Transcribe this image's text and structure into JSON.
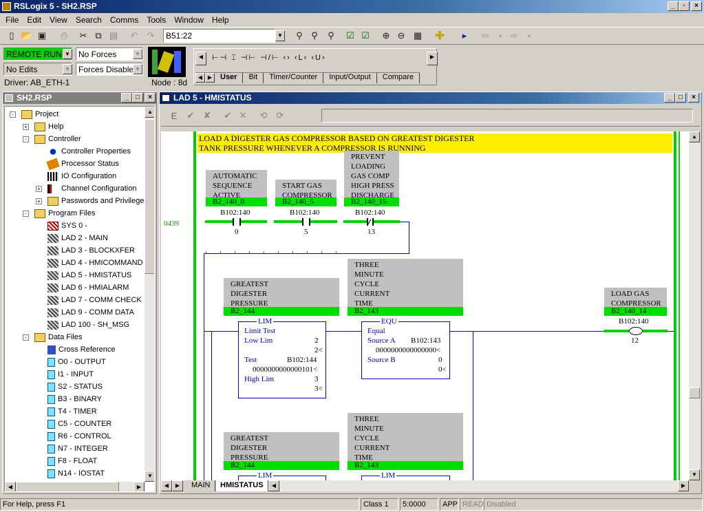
{
  "app": {
    "title": "RSLogix 5 - SH2.RSP",
    "menu": [
      "File",
      "Edit",
      "View",
      "Search",
      "Comms",
      "Tools",
      "Window",
      "Help"
    ]
  },
  "toolbar": {
    "address_value": "B51:22"
  },
  "online": {
    "mode": "REMOTE RUN",
    "forces": "No Forces",
    "edits": "No Edits",
    "forces_state": "Forces Disabled",
    "driver": "Driver: AB_ETH-1",
    "node": "Node : 8d"
  },
  "instruction_tabs": [
    "User",
    "Bit",
    "Timer/Counter",
    "Input/Output",
    "Compare"
  ],
  "project_panel": {
    "title": "SH2.RSP",
    "items": [
      {
        "label": "Project",
        "level": 0,
        "icon": "folder-icon",
        "exp": "-"
      },
      {
        "label": "Help",
        "level": 1,
        "icon": "folder-icon",
        "exp": "+"
      },
      {
        "label": "Controller",
        "level": 1,
        "icon": "folder-icon",
        "exp": "-"
      },
      {
        "label": "Controller Properties",
        "level": 2,
        "icon": "info-icon"
      },
      {
        "label": "Processor Status",
        "level": 2,
        "icon": "status-icon"
      },
      {
        "label": "IO Configuration",
        "level": 2,
        "icon": "io-icon"
      },
      {
        "label": "Channel Configuration",
        "level": 2,
        "icon": "channel-icon",
        "exp": "+"
      },
      {
        "label": "Passwords and Privileges",
        "level": 2,
        "icon": "folder-icon",
        "exp": "+"
      },
      {
        "label": "Program Files",
        "level": 1,
        "icon": "folder-icon",
        "exp": "-"
      },
      {
        "label": "SYS 0 -",
        "level": 2,
        "icon": "sys-file-icon"
      },
      {
        "label": "LAD 2 - MAIN",
        "level": 2,
        "icon": "ladder-file-icon"
      },
      {
        "label": "LAD 3 - BLOCKXFER",
        "level": 2,
        "icon": "ladder-file-icon"
      },
      {
        "label": "LAD 4 - HMICOMMAND",
        "level": 2,
        "icon": "ladder-file-icon"
      },
      {
        "label": "LAD 5 - HMISTATUS",
        "level": 2,
        "icon": "ladder-file-icon"
      },
      {
        "label": "LAD 6 - HMIALARM",
        "level": 2,
        "icon": "ladder-file-icon"
      },
      {
        "label": "LAD 7 - COMM CHECK",
        "level": 2,
        "icon": "ladder-file-icon"
      },
      {
        "label": "LAD 9 - COMM DATA",
        "level": 2,
        "icon": "ladder-file-icon"
      },
      {
        "label": "LAD 100 - SH_MSG",
        "level": 2,
        "icon": "ladder-file-icon"
      },
      {
        "label": "Data Files",
        "level": 1,
        "icon": "folder-icon",
        "exp": "-"
      },
      {
        "label": "Cross Reference",
        "level": 2,
        "icon": "cross-reference-icon"
      },
      {
        "label": "O0 - OUTPUT",
        "level": 2,
        "icon": "data-file-icon"
      },
      {
        "label": "I1 - INPUT",
        "level": 2,
        "icon": "data-file-icon"
      },
      {
        "label": "S2 - STATUS",
        "level": 2,
        "icon": "data-file-icon"
      },
      {
        "label": "B3 - BINARY",
        "level": 2,
        "icon": "data-file-icon"
      },
      {
        "label": "T4 - TIMER",
        "level": 2,
        "icon": "data-file-icon"
      },
      {
        "label": "C5 - COUNTER",
        "level": 2,
        "icon": "data-file-icon"
      },
      {
        "label": "R6 - CONTROL",
        "level": 2,
        "icon": "data-file-icon"
      },
      {
        "label": "N7 - INTEGER",
        "level": 2,
        "icon": "data-file-icon"
      },
      {
        "label": "F8 - FLOAT",
        "level": 2,
        "icon": "data-file-icon"
      },
      {
        "label": "N14 - IOSTAT",
        "level": 2,
        "icon": "data-file-icon"
      }
    ]
  },
  "ladder_window": {
    "title": "LAD 5 - HMISTATUS",
    "comment_line1": "LOAD A DIGESTER GAS COMPRESSOR BASED ON GREATEST DIGESTER",
    "comment_line2": "TANK PRESSURE WHENEVER A COMPRESSOR IS RUNNING",
    "rung_number": "0439",
    "contacts": [
      {
        "desc": [
          "AUTOMATIC",
          "SEQUENCE",
          "ACTIVE"
        ],
        "symbol": "B2_140_0",
        "address": "B102:140",
        "bit": "0"
      },
      {
        "desc": [
          "START GAS",
          "COMPRESSOR"
        ],
        "symbol": "B2_140_5",
        "address": "B102:140",
        "bit": "5"
      },
      {
        "desc": [
          "PREVENT",
          "LOADING",
          "GAS COMP",
          "HIGH PRESS",
          "DISCHARGE"
        ],
        "symbol": "B2_140_15",
        "address": "B102:140",
        "bit": "13"
      }
    ],
    "lim": {
      "desc": [
        "GREATEST",
        "DIGESTER",
        "PRESSURE"
      ],
      "symbol": "B2_144",
      "name": "LIM",
      "title": "Limit Test",
      "low_lim_label": "Low Lim",
      "low_lim": "2",
      "low_lim_val": "2<",
      "test_label": "Test",
      "test_addr": "B102:144",
      "test_bits": "0000000000000101<",
      "high_lim_label": "High Lim",
      "high_lim": "3",
      "high_lim_val": "3<"
    },
    "equ": {
      "desc": [
        "THREE",
        "MINUTE",
        "CYCLE",
        "CURRENT",
        "TIME"
      ],
      "symbol": "B2_143",
      "name": "EQU",
      "title": "Equal",
      "source_a_label": "Source A",
      "source_a_addr": "B102:143",
      "source_a_bits": "0000000000000000<",
      "source_b_label": "Source B",
      "source_b": "0",
      "source_b_val": "0<"
    },
    "output": {
      "desc": [
        "LOAD GAS",
        "COMPRESSOR"
      ],
      "symbol": "B2_140_14",
      "address": "B102:140",
      "bit": "12"
    },
    "lower_lim": {
      "desc": [
        "GREATEST",
        "DIGESTER",
        "PRESSURE"
      ],
      "symbol": "B2_144",
      "name": "LIM"
    },
    "lower_equ": {
      "desc": [
        "THREE",
        "MINUTE",
        "CYCLE",
        "CURRENT",
        "TIME"
      ],
      "symbol": "B2_143",
      "name": "LIM"
    },
    "tabs": [
      "MAIN",
      "HMISTATUS"
    ]
  },
  "status_bar": {
    "help": "For Help, press F1",
    "class": "Class 1",
    "position": "5:0000",
    "app": "APP",
    "read": "READ",
    "disabled": "Disabled"
  }
}
